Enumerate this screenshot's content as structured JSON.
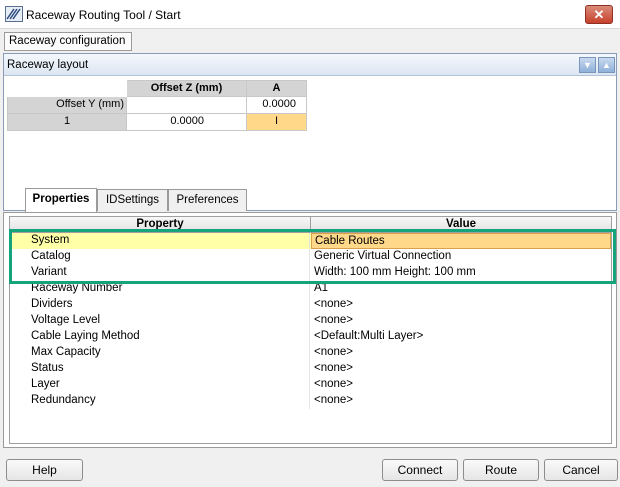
{
  "window": {
    "title": "Raceway Routing Tool / Start",
    "close_label": "✕"
  },
  "toolbar": {
    "raceway_config_label": "Raceway configuration"
  },
  "layout": {
    "title": "Raceway layout",
    "pin_down": "▼",
    "pin_up": "▲",
    "col_offset_z": "Offset Z (mm)",
    "col_a": "A",
    "row_offset_y_label": "Offset Y (mm)",
    "row_offset_y_a": "0.0000",
    "row1_index": "1",
    "row1_offset_z": "0.0000",
    "row1_a": "I",
    "highlight_color": "#ffd88a"
  },
  "tabs": [
    {
      "label": "Properties"
    },
    {
      "label": "IDSettings"
    },
    {
      "label": "Preferences"
    }
  ],
  "properties": {
    "col_property": "Property",
    "col_value": "Value",
    "rows": [
      {
        "name": "System",
        "value": "Cable Routes"
      },
      {
        "name": "Catalog",
        "value": "Generic Virtual Connection"
      },
      {
        "name": "Variant",
        "value": "Width: 100 mm  Height: 100 mm"
      },
      {
        "name": "Raceway Number",
        "value": "A1"
      },
      {
        "name": "Dividers",
        "value": "<none>"
      },
      {
        "name": "Voltage Level",
        "value": "<none>"
      },
      {
        "name": "Cable Laying Method",
        "value": "<Default:Multi Layer>"
      },
      {
        "name": "Max Capacity",
        "value": "<none>"
      },
      {
        "name": "Status",
        "value": "<none>"
      },
      {
        "name": "Layer",
        "value": "<none>"
      },
      {
        "name": "Redundancy",
        "value": "<none>"
      }
    ]
  },
  "buttons": {
    "help": "Help",
    "connect": "Connect",
    "route": "Route",
    "cancel": "Cancel"
  },
  "colors": {
    "highlight_frame": "#15a37c",
    "selected_row": "#ffffa8",
    "selected_value": "#ffd88a"
  }
}
